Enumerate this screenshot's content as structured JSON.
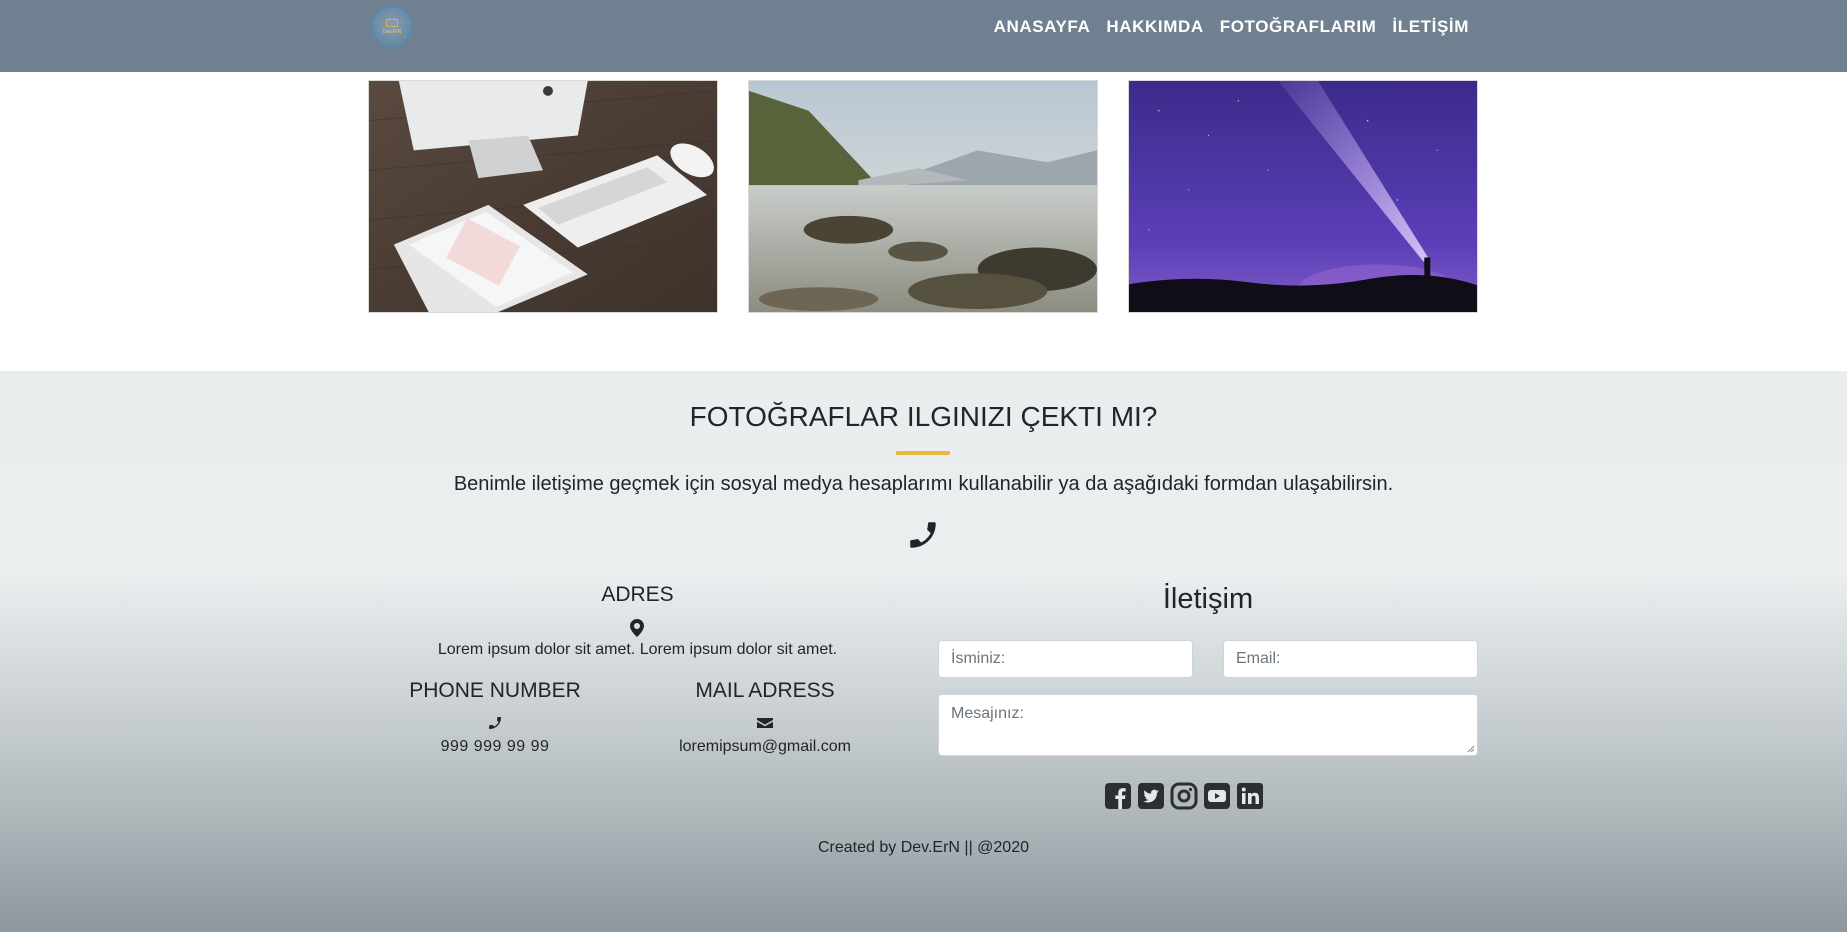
{
  "navbar": {
    "logo_text": "Dev.ErN",
    "links": [
      "ANASAYFA",
      "HAKKIMDA",
      "FOTOĞRAFLARIM",
      "İLETİŞİM"
    ]
  },
  "gallery": {
    "photos": [
      "desk-computer-photo",
      "lake-mountain-photo",
      "night-sky-photo"
    ]
  },
  "contact": {
    "title": "FOTOĞRAFLAR ILGINIZI ÇEKTI MI?",
    "description": "Benimle iletişime geçmek için sosyal medya hesaplarımı kullanabilir ya da aşağıdaki formdan ulaşabilirsin.",
    "adres_title": "ADRES",
    "adres_text": "Lorem ipsum dolor sit amet. Lorem ipsum dolor sit amet.",
    "phone_title": "PHONE NUMBER",
    "phone_text": "999 999 99 99",
    "mail_title": "MAIL ADRESS",
    "mail_text": "loremipsum@gmail.com",
    "accent_color": "#e8b839"
  },
  "form": {
    "title": "İletişim",
    "name_placeholder": "İsminiz:",
    "email_placeholder": "Email:",
    "message_placeholder": "Mesajınız:"
  },
  "socials": [
    "facebook-icon",
    "twitter-icon",
    "instagram-icon",
    "youtube-icon",
    "linkedin-icon"
  ],
  "footer": {
    "credit": "Created by Dev.ErN || @2020"
  },
  "colors": {
    "navbar_bg": "#708090"
  }
}
